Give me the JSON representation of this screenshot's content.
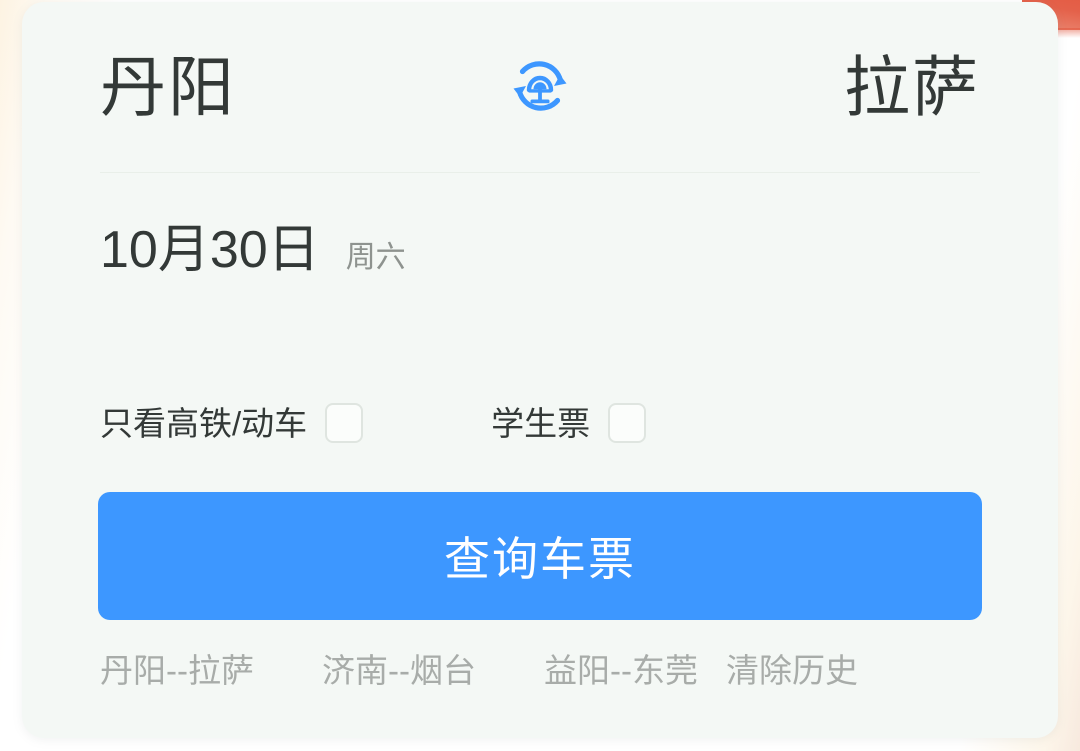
{
  "theme": {
    "card_bg": "#f4f8f5",
    "accent_blue": "#3d97ff",
    "text_dark": "#333937",
    "text_muted": "#8e938f",
    "text_history": "#a8aca9",
    "checkbox_border": "#dfe5e0",
    "divider": "#e9efe9",
    "page_bg_warm": "#fdf3e2",
    "page_bg_red": "#e2543c"
  },
  "route": {
    "from_station": "丹阳",
    "to_station": "拉萨",
    "swap_icon": "china-railway-swap-icon"
  },
  "date": {
    "value": "10月30日",
    "weekday": "周六"
  },
  "options": [
    {
      "label": "只看高铁/动车",
      "checked": false
    },
    {
      "label": "学生票",
      "checked": false
    }
  ],
  "query": {
    "label": "查询车票"
  },
  "history": {
    "items": [
      {
        "label": "丹阳--拉萨"
      },
      {
        "label": "济南--烟台"
      },
      {
        "label": "益阳--东莞"
      }
    ],
    "clear_label": "清除历史"
  }
}
